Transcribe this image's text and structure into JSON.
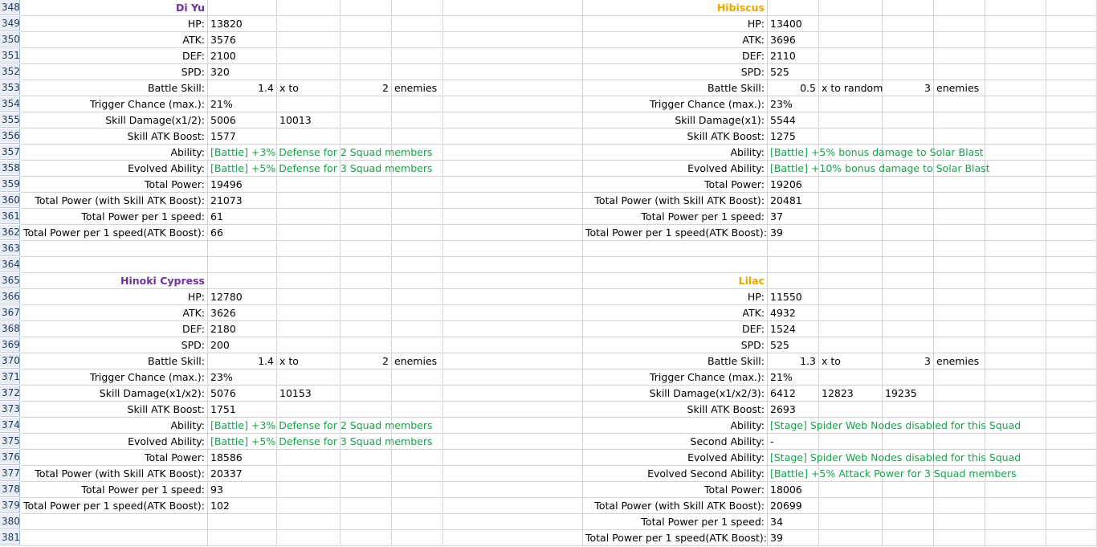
{
  "row_numbers": [
    "348",
    "349",
    "350",
    "351",
    "352",
    "353",
    "354",
    "355",
    "356",
    "357",
    "358",
    "359",
    "360",
    "361",
    "362",
    "363",
    "364",
    "365",
    "366",
    "367",
    "368",
    "369",
    "370",
    "371",
    "372",
    "373",
    "374",
    "375",
    "376",
    "377",
    "378",
    "379",
    "380",
    "381"
  ],
  "left_top": {
    "name": "Di Yu",
    "hp_label": "HP:",
    "hp": "13820",
    "atk_label": "ATK:",
    "atk": "3576",
    "def_label": "DEF:",
    "def": "2100",
    "spd_label": "SPD:",
    "spd": "320",
    "bs_label": "Battle Skill:",
    "bs_mult": "1.4",
    "bs_mid": "x to",
    "bs_count": "2",
    "bs_unit": "enemies",
    "tc_label": "Trigger Chance (max.):",
    "tc": "21%",
    "sd_label": "Skill Damage(x1/2):",
    "sd1": "5006",
    "sd2": "10013",
    "sab_label": "Skill ATK Boost:",
    "sab": "1577",
    "ab_label": "Ability:",
    "ab": "[Battle] +3% Defense for 2 Squad members",
    "eab_label": "Evolved Ability:",
    "eab": "[Battle] +5% Defense for 3 Squad members",
    "tp_label": "Total Power:",
    "tp": "19496",
    "tpb_label": "Total Power (with Skill ATK Boost):",
    "tpb": "21073",
    "tps_label": "Total Power per 1 speed:",
    "tps": "61",
    "tpsb_label": "Total Power per 1 speed(ATK Boost):",
    "tpsb": "66"
  },
  "right_top": {
    "name": "Hibiscus",
    "hp_label": "HP:",
    "hp": "13400",
    "atk_label": "ATK:",
    "atk": "3696",
    "def_label": "DEF:",
    "def": "2110",
    "spd_label": "SPD:",
    "spd": "525",
    "bs_label": "Battle Skill:",
    "bs_mult": "0.5",
    "bs_mid": "x to random",
    "bs_count": "3",
    "bs_unit": "enemies",
    "tc_label": "Trigger Chance (max.):",
    "tc": "23%",
    "sd_label": "Skill Damage(x1):",
    "sd1": "5544",
    "sab_label": "Skill ATK Boost:",
    "sab": "1275",
    "ab_label": "Ability:",
    "ab": "[Battle] +5% bonus damage to Solar Blast",
    "eab_label": "Evolved Ability:",
    "eab": "[Battle] +10% bonus damage to Solar Blast",
    "tp_label": "Total Power:",
    "tp": "19206",
    "tpb_label": "Total Power (with Skill ATK Boost):",
    "tpb": "20481",
    "tps_label": "Total Power per 1 speed:",
    "tps": "37",
    "tpsb_label": "Total Power per 1 speed(ATK Boost):",
    "tpsb": "39"
  },
  "left_bottom": {
    "name": "Hinoki Cypress",
    "hp_label": "HP:",
    "hp": "12780",
    "atk_label": "ATK:",
    "atk": "3626",
    "def_label": "DEF:",
    "def": "2180",
    "spd_label": "SPD:",
    "spd": "200",
    "bs_label": "Battle Skill:",
    "bs_mult": "1.4",
    "bs_mid": "x to",
    "bs_count": "2",
    "bs_unit": "enemies",
    "tc_label": "Trigger Chance (max.):",
    "tc": "23%",
    "sd_label": "Skill Damage(x1/x2):",
    "sd1": "5076",
    "sd2": "10153",
    "sab_label": "Skill ATK Boost:",
    "sab": "1751",
    "ab_label": "Ability:",
    "ab": "[Battle] +3% Defense for 2 Squad members",
    "eab_label": "Evolved Ability:",
    "eab": "[Battle] +5% Defense for 3 Squad members",
    "tp_label": "Total Power:",
    "tp": "18586",
    "tpb_label": "Total Power (with Skill ATK Boost):",
    "tpb": "20337",
    "tps_label": "Total Power per 1 speed:",
    "tps": "93",
    "tpsb_label": "Total Power per 1 speed(ATK Boost):",
    "tpsb": "102"
  },
  "right_bottom": {
    "name": "Lilac",
    "hp_label": "HP:",
    "hp": "11550",
    "atk_label": "ATK:",
    "atk": "4932",
    "def_label": "DEF:",
    "def": "1524",
    "spd_label": "SPD:",
    "spd": "525",
    "bs_label": "Battle Skill:",
    "bs_mult": "1.3",
    "bs_mid": "x to",
    "bs_count": "3",
    "bs_unit": "enemies",
    "tc_label": "Trigger Chance (max.):",
    "tc": "21%",
    "sd_label": "Skill Damage(x1/x2/3):",
    "sd1": "6412",
    "sd2": "12823",
    "sd3": "19235",
    "sab_label": "Skill ATK Boost:",
    "sab": "2693",
    "ab_label": "Ability:",
    "ab": "[Stage] Spider Web Nodes disabled for this Squad",
    "sab2_label": "Second Ability:",
    "sab2": "-",
    "eab_label": "Evolved Ability:",
    "eab": "[Stage] Spider Web Nodes disabled for this Squad",
    "esab_label": "Evolved Second Ability:",
    "esab": "[Battle] +5% Attack Power for 3 Squad members",
    "tp_label": "Total Power:",
    "tp": "18006",
    "tpb_label": "Total Power (with Skill ATK Boost):",
    "tpb": "20699",
    "tps_label": "Total Power per 1 speed:",
    "tps": "34",
    "tpsb_label": "Total Power per 1 speed(ATK Boost):",
    "tpsb": "39"
  },
  "colors": {
    "purple_name": "#7030a0",
    "gold_name": "#e6a800",
    "ability_green": "#16a34a",
    "header_bg": "#e9eef5"
  }
}
